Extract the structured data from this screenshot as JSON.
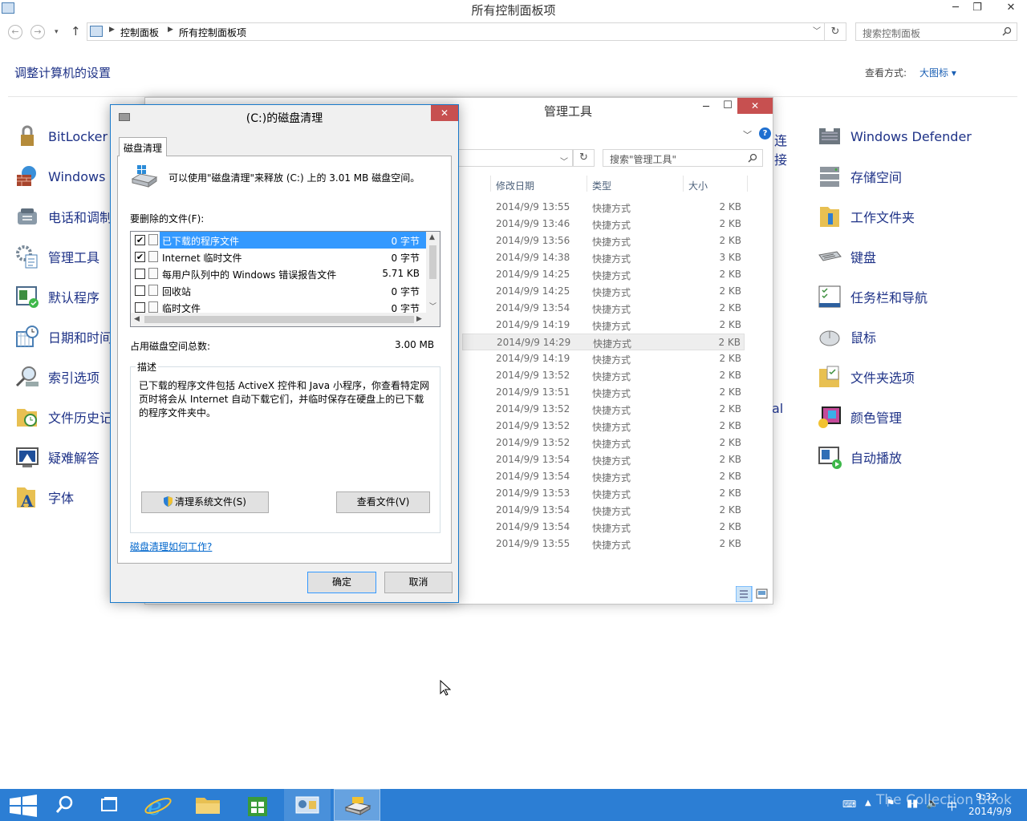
{
  "control_panel": {
    "title": "所有控制面板项",
    "breadcrumb": [
      "控制面板",
      "所有控制面板项"
    ],
    "search_placeholder": "搜索控制面板",
    "heading": "调整计算机的设置",
    "view_by_label": "查看方式:",
    "view_by_value": "大图标 ▾",
    "left_items": [
      {
        "label": "BitLocker",
        "icon": "bitlocker-icon"
      },
      {
        "label": "Windows",
        "icon": "firewall-icon"
      },
      {
        "label": "电话和调制",
        "icon": "phone-modem-icon"
      },
      {
        "label": "管理工具",
        "icon": "admin-tools-icon"
      },
      {
        "label": "默认程序",
        "icon": "default-programs-icon"
      },
      {
        "label": "日期和时间",
        "icon": "date-time-icon"
      },
      {
        "label": "索引选项",
        "icon": "indexing-icon"
      },
      {
        "label": "文件历史记",
        "icon": "file-history-icon"
      },
      {
        "label": "疑难解答",
        "icon": "troubleshoot-icon"
      },
      {
        "label": "字体",
        "icon": "fonts-icon"
      }
    ],
    "right_items": [
      {
        "label": "Windows Defender",
        "icon": "defender-icon"
      },
      {
        "label": "存储空间",
        "icon": "storage-spaces-icon"
      },
      {
        "label": "工作文件夹",
        "icon": "work-folders-icon"
      },
      {
        "label": "键盘",
        "icon": "keyboard-icon"
      },
      {
        "label": "任务栏和导航",
        "icon": "taskbar-nav-icon"
      },
      {
        "label": "鼠标",
        "icon": "mouse-icon"
      },
      {
        "label": "文件夹选项",
        "icon": "folder-options-icon"
      },
      {
        "label": "颜色管理",
        "icon": "color-management-icon"
      },
      {
        "label": "自动播放",
        "icon": "autoplay-icon"
      }
    ],
    "partial_texts": {
      "connect": "连接",
      "al": "al"
    }
  },
  "admin_tools": {
    "title": "管理工具",
    "search_placeholder": "搜索\"管理工具\"",
    "columns": {
      "date": "修改日期",
      "type": "类型",
      "size": "大小"
    },
    "rows": [
      {
        "date": "2014/9/9 13:55",
        "type": "快捷方式",
        "size": "2 KB"
      },
      {
        "date": "2014/9/9 13:46",
        "type": "快捷方式",
        "size": "2 KB"
      },
      {
        "date": "2014/9/9 13:56",
        "type": "快捷方式",
        "size": "2 KB"
      },
      {
        "date": "2014/9/9 14:38",
        "type": "快捷方式",
        "size": "3 KB"
      },
      {
        "date": "2014/9/9 14:25",
        "type": "快捷方式",
        "size": "2 KB"
      },
      {
        "date": "2014/9/9 14:25",
        "type": "快捷方式",
        "size": "2 KB"
      },
      {
        "date": "2014/9/9 13:54",
        "type": "快捷方式",
        "size": "2 KB"
      },
      {
        "date": "2014/9/9 14:19",
        "type": "快捷方式",
        "size": "2 KB"
      },
      {
        "date": "2014/9/9 14:29",
        "type": "快捷方式",
        "size": "2 KB"
      },
      {
        "date": "2014/9/9 14:19",
        "type": "快捷方式",
        "size": "2 KB"
      },
      {
        "date": "2014/9/9 13:52",
        "type": "快捷方式",
        "size": "2 KB"
      },
      {
        "date": "2014/9/9 13:51",
        "type": "快捷方式",
        "size": "2 KB"
      },
      {
        "date": "2014/9/9 13:52",
        "type": "快捷方式",
        "size": "2 KB"
      },
      {
        "date": "2014/9/9 13:52",
        "type": "快捷方式",
        "size": "2 KB"
      },
      {
        "date": "2014/9/9 13:52",
        "type": "快捷方式",
        "size": "2 KB"
      },
      {
        "date": "2014/9/9 13:54",
        "type": "快捷方式",
        "size": "2 KB"
      },
      {
        "date": "2014/9/9 13:54",
        "type": "快捷方式",
        "size": "2 KB"
      },
      {
        "date": "2014/9/9 13:53",
        "type": "快捷方式",
        "size": "2 KB"
      },
      {
        "date": "2014/9/9 13:54",
        "type": "快捷方式",
        "size": "2 KB"
      },
      {
        "date": "2014/9/9 13:54",
        "type": "快捷方式",
        "size": "2 KB"
      },
      {
        "date": "2014/9/9 13:55",
        "type": "快捷方式",
        "size": "2 KB"
      }
    ]
  },
  "disk_cleanup": {
    "title": "(C:)的磁盘清理",
    "tab": "磁盘清理",
    "info": "可以使用\"磁盘清理\"来释放  (C:) 上的 3.01 MB 磁盘空间。",
    "files_label": "要删除的文件(F):",
    "files": [
      {
        "name": "已下载的程序文件",
        "size": "0 字节",
        "checked": true
      },
      {
        "name": "Internet 临时文件",
        "size": "0 字节",
        "checked": true
      },
      {
        "name": "每用户队列中的 Windows 错误报告文件",
        "size": "5.71 KB",
        "checked": false
      },
      {
        "name": "回收站",
        "size": "0 字节",
        "checked": false
      },
      {
        "name": "临时文件",
        "size": "0 字节",
        "checked": false
      }
    ],
    "total_label": "占用磁盘空间总数:",
    "total_value": "3.00 MB",
    "desc_legend": "描述",
    "description": "已下载的程序文件包括 ActiveX 控件和 Java 小程序，你查看特定网页时将会从 Internet 自动下载它们，并临时保存在硬盘上的已下载的程序文件夹中。",
    "clean_system_button": "清理系统文件(S)",
    "view_files_button": "查看文件(V)",
    "how_link": "磁盘清理如何工作?",
    "ok_button": "确定",
    "cancel_button": "取消"
  },
  "taskbar": {
    "time": "9:32",
    "date": "2014/9/9",
    "ime": "中",
    "watermark": "The Collection Book"
  },
  "colors": {
    "link_blue": "#1e3287",
    "taskbar": "#2c7ed4",
    "selection": "#3399ff",
    "close_red": "#c75050"
  }
}
